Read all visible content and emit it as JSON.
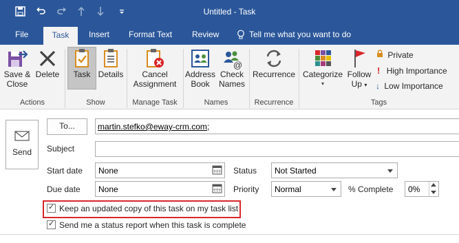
{
  "window": {
    "title": "Untitled  -  Task"
  },
  "qat": {
    "save_icon": "save-icon",
    "undo_icon": "undo-icon",
    "redo_icon": "redo-icon",
    "up_icon": "up-arrow-icon",
    "down_icon": "down-arrow-icon",
    "customize_icon": "customize-qat-icon"
  },
  "tabs": [
    {
      "label": "File"
    },
    {
      "label": "Task",
      "active": true
    },
    {
      "label": "Insert"
    },
    {
      "label": "Format Text"
    },
    {
      "label": "Review"
    }
  ],
  "tell_me": "Tell me what you want to do",
  "ribbon": {
    "groups": {
      "actions": "Actions",
      "show": "Show",
      "manage_task": "Manage Task",
      "names": "Names",
      "recurrence": "Recurrence",
      "tags": "Tags"
    },
    "buttons": {
      "save_close_1": "Save &",
      "save_close_2": "Close",
      "delete": "Delete",
      "task": "Task",
      "details": "Details",
      "cancel_assignment_1": "Cancel",
      "cancel_assignment_2": "Assignment",
      "address_book_1": "Address",
      "address_book_2": "Book",
      "check_names_1": "Check",
      "check_names_2": "Names",
      "recurrence": "Recurrence",
      "categorize": "Categorize",
      "follow_up_1": "Follow",
      "follow_up_2": "Up",
      "private": "Private",
      "high_importance": "High Importance",
      "low_importance": "Low Importance"
    }
  },
  "form": {
    "send": "Send",
    "to_button": "To...",
    "to_value": "martin.stefko@eway-crm.com;",
    "subject_label": "Subject",
    "subject_value": "",
    "start_date_label": "Start date",
    "start_date_value": "None",
    "due_date_label": "Due date",
    "due_date_value": "None",
    "status_label": "Status",
    "status_value": "Not Started",
    "priority_label": "Priority",
    "priority_value": "Normal",
    "complete_label": "% Complete",
    "complete_value": "0%",
    "keep_copy": "Keep an updated copy of this task on my task list",
    "send_report": "Send me a status report when this task is complete"
  },
  "colors": {
    "accent": "#2b579a",
    "highlight": "#d9262a",
    "ribbon_bg": "#f3f3f3"
  }
}
